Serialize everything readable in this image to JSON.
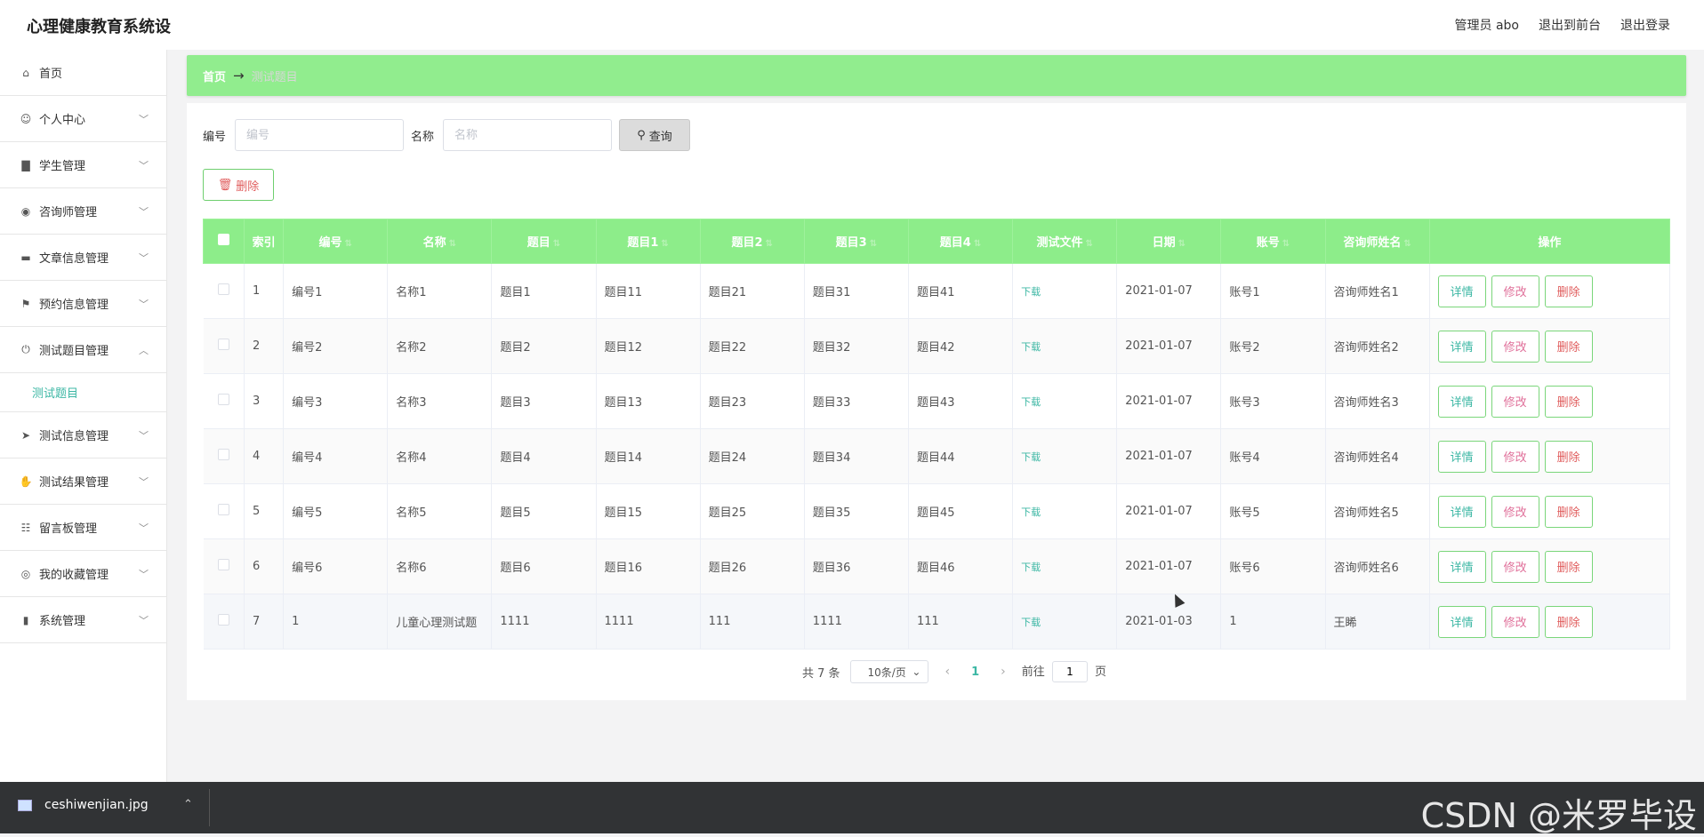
{
  "app": {
    "title": "心理健康教育系统设"
  },
  "header": {
    "user": "管理员 abo",
    "front": "退出到前台",
    "logout": "退出登录"
  },
  "sidebar": {
    "items": [
      {
        "label": "首页",
        "icon": "home-icon",
        "chev": ""
      },
      {
        "label": "个人中心",
        "icon": "user-icon",
        "chev": "﹀"
      },
      {
        "label": "学生管理",
        "icon": "bar-chart-icon",
        "chev": "﹀"
      },
      {
        "label": "咨询师管理",
        "icon": "location-icon",
        "chev": "﹀"
      },
      {
        "label": "文章信息管理",
        "icon": "monitor-icon",
        "chev": "﹀"
      },
      {
        "label": "预约信息管理",
        "icon": "flag-icon",
        "chev": "﹀"
      },
      {
        "label": "测试题目管理",
        "icon": "power-icon",
        "chev": "︿"
      },
      {
        "label": "测试信息管理",
        "icon": "send-icon",
        "chev": "﹀"
      },
      {
        "label": "测试结果管理",
        "icon": "thumb-icon",
        "chev": "﹀"
      },
      {
        "label": "留言板管理",
        "icon": "clipboard-icon",
        "chev": "﹀"
      },
      {
        "label": "我的收藏管理",
        "icon": "circle-icon",
        "chev": "﹀"
      },
      {
        "label": "系统管理",
        "icon": "ticket-icon",
        "chev": "﹀"
      }
    ],
    "subitem": "测试题目"
  },
  "breadcrumb": {
    "home": "首页",
    "arrow": "→",
    "current": "测试题目"
  },
  "search": {
    "code_label": "编号",
    "code_placeholder": "编号",
    "name_label": "名称",
    "name_placeholder": "名称",
    "query_label": "查询"
  },
  "toolbar": {
    "delete_label": "删除"
  },
  "table": {
    "headers": [
      "索引",
      "编号",
      "名称",
      "题目",
      "题目1",
      "题目2",
      "题目3",
      "题目4",
      "测试文件",
      "日期",
      "账号",
      "咨询师姓名",
      "操作"
    ],
    "rows": [
      [
        "1",
        "编号1",
        "名称1",
        "题目1",
        "题目11",
        "题目21",
        "题目31",
        "题目41",
        "下载",
        "2021-01-07",
        "账号1",
        "咨询师姓名1"
      ],
      [
        "2",
        "编号2",
        "名称2",
        "题目2",
        "题目12",
        "题目22",
        "题目32",
        "题目42",
        "下载",
        "2021-01-07",
        "账号2",
        "咨询师姓名2"
      ],
      [
        "3",
        "编号3",
        "名称3",
        "题目3",
        "题目13",
        "题目23",
        "题目33",
        "题目43",
        "下载",
        "2021-01-07",
        "账号3",
        "咨询师姓名3"
      ],
      [
        "4",
        "编号4",
        "名称4",
        "题目4",
        "题目14",
        "题目24",
        "题目34",
        "题目44",
        "下载",
        "2021-01-07",
        "账号4",
        "咨询师姓名4"
      ],
      [
        "5",
        "编号5",
        "名称5",
        "题目5",
        "题目15",
        "题目25",
        "题目35",
        "题目45",
        "下载",
        "2021-01-07",
        "账号5",
        "咨询师姓名5"
      ],
      [
        "6",
        "编号6",
        "名称6",
        "题目6",
        "题目16",
        "题目26",
        "题目36",
        "题目46",
        "下载",
        "2021-01-07",
        "账号6",
        "咨询师姓名6"
      ],
      [
        "7",
        "1",
        "儿童心理测试题",
        "1111",
        "1111",
        "111",
        "1111",
        "111",
        "下载",
        "2021-01-03",
        "1",
        "王睎"
      ]
    ],
    "actions": {
      "detail": "详情",
      "edit": "修改",
      "remove": "删除"
    }
  },
  "pagination": {
    "total": "共 7 条",
    "page_size": "10条/页",
    "current": "1",
    "goto_prefix": "前往",
    "goto_value": "1",
    "goto_suffix": "页"
  },
  "taskbar": {
    "filename": "ceshiwenjian.jpg"
  },
  "watermark": "CSDN @米罗毕设"
}
